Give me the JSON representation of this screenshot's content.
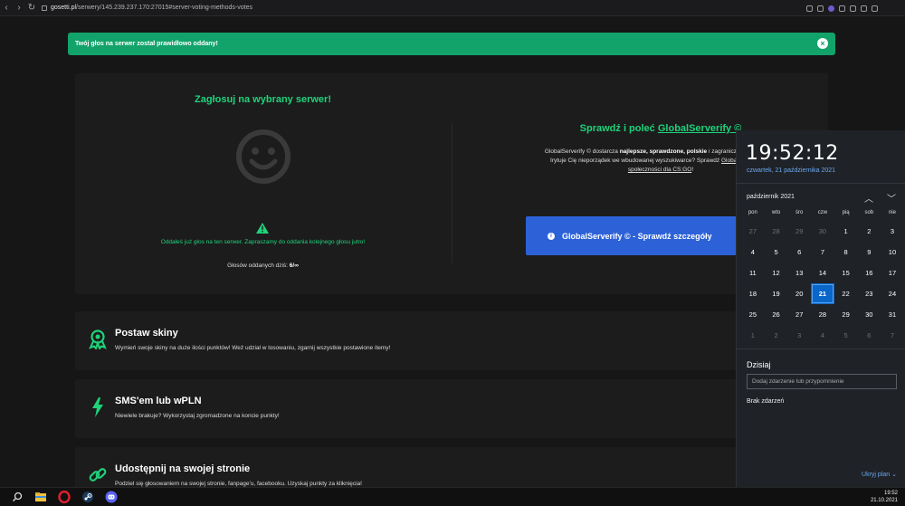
{
  "browser": {
    "url_domain": "gosetti.pl",
    "url_path": "/serwery/145.239.237.170:27015#server-voting-methods-votes"
  },
  "alert": {
    "text": "Twój głos na serwer został prawidłowo oddany!",
    "close_symbol": "×"
  },
  "vote": {
    "title": "Zagłosuj na wybrany serwer!",
    "message": "Oddałeś już głos na ten serwer. Zapraszamy do oddania kolejnego głosu jutro!",
    "count_label": "Głosów oddanych dziś:",
    "count_value": "6/∞"
  },
  "globalserverify": {
    "title_prefix": "Sprawdź i poleć",
    "title_link": "GlobalServerify ©",
    "desc_1": "GlobalServerify © dostarcza",
    "desc_bold": "najlepsze, sprawdzone, polskie",
    "desc_2": "i zagraniczne serwery bez",
    "desc_3": "Irytuje Cię nieporządek we wbudowanej wyszukiwarce? Sprawdź",
    "desc_link_1": "GlobalServerify © -",
    "desc_link_2": "społeczności dla CS:GO",
    "desc_end": "!",
    "button_label": "GlobalServerify © - Sprawdź szczegóły",
    "button_icon": "info-icon"
  },
  "features": [
    {
      "title": "Postaw skiny",
      "desc": "Wymień swoje skiny na duże ilości punktów! Weź udział w losowaniu, zgarnij wszystkie postawione itemy!",
      "icon": "award-icon"
    },
    {
      "title": "SMS'em lub wPLN",
      "desc": "Niewiele brakuje? Wykorzystaj zgromadzone na koncie punkty!",
      "icon": "lightning-icon"
    },
    {
      "title": "Udostępnij na swojej stronie",
      "desc": "Podziel się głosowaniem na swojej stronie, fanpage'u, facebooku. Uzyskaj punkty za kliknięcia!",
      "icon": "link-icon"
    }
  ],
  "calendar": {
    "time": "19:52:12",
    "date": "czwartek, 21 października 2021",
    "month": "październik 2021",
    "weekdays": [
      "pon",
      "wto",
      "śro",
      "czw",
      "pią",
      "sob",
      "nie"
    ],
    "weeks": [
      [
        "27",
        "28",
        "29",
        "30",
        "1",
        "2",
        "3"
      ],
      [
        "4",
        "5",
        "6",
        "7",
        "8",
        "9",
        "10"
      ],
      [
        "11",
        "12",
        "13",
        "14",
        "15",
        "16",
        "17"
      ],
      [
        "18",
        "19",
        "20",
        "21",
        "22",
        "23",
        "24"
      ],
      [
        "25",
        "26",
        "27",
        "28",
        "29",
        "30",
        "31"
      ],
      [
        "1",
        "2",
        "3",
        "4",
        "5",
        "6",
        "7"
      ]
    ],
    "today_label": "Dzisiaj",
    "event_placeholder": "Dodaj zdarzenie lub przypomnienie",
    "no_events": "Brak zdarzeń",
    "hide_plan": "Ukryj plan"
  },
  "taskbar": {
    "time": "19:52",
    "date": "21.10.2021"
  },
  "colors": {
    "accent_green": "#1fd27a",
    "alert_green": "#12a36a",
    "button_blue": "#2c61d8",
    "calendar_today": "#0a67c9"
  }
}
